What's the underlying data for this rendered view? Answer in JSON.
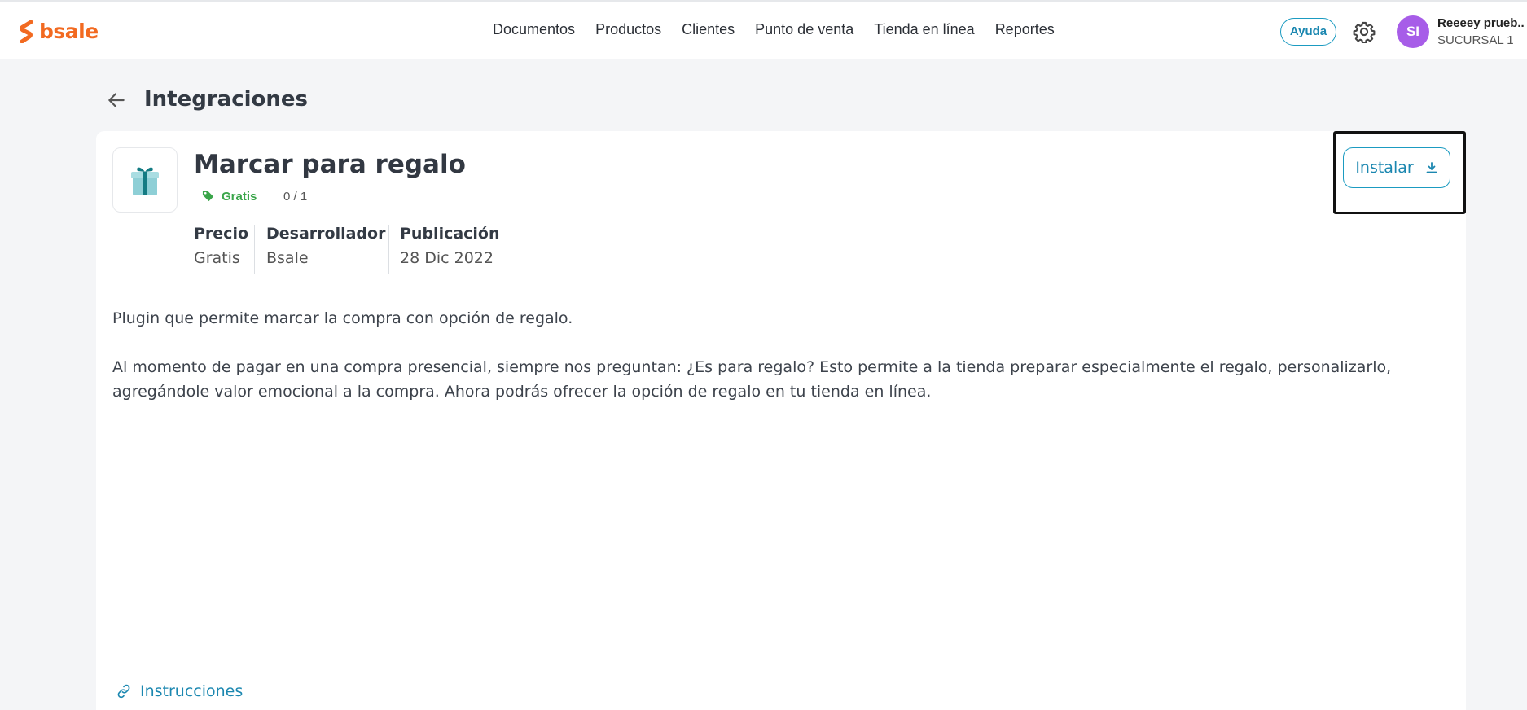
{
  "header": {
    "logo_text": "bsale",
    "nav": [
      "Documentos",
      "Productos",
      "Clientes",
      "Punto de venta",
      "Tienda en línea",
      "Reportes"
    ],
    "help_label": "Ayuda",
    "avatar_initials": "SI",
    "user_name": "Reeeey prueb..",
    "branch": "SUCURSAL 1"
  },
  "page": {
    "title": "Integraciones"
  },
  "app": {
    "name": "Marcar para regalo",
    "tag": "Gratis",
    "installs": "0 / 1",
    "meta": [
      {
        "label": "Precio",
        "value": "Gratis"
      },
      {
        "label": "Desarrollador",
        "value": "Bsale"
      },
      {
        "label": "Publicación",
        "value": "28 Dic 2022"
      }
    ],
    "install_label": "Instalar",
    "description": [
      "Plugin que permite marcar la compra con opción de regalo.",
      "Al momento de pagar en una compra presencial, siempre nos preguntan: ¿Es para regalo? Esto permite a la tienda preparar especialmente el regalo, personalizarlo,",
      "agregándole valor emocional a la compra. Ahora podrás ofrecer la opción de regalo en tu tienda en línea."
    ],
    "instructions_label": "Instrucciones"
  },
  "colors": {
    "brand": "#f26a21",
    "accent": "#1b87b0",
    "free_tag": "#3aa54a",
    "avatar": "#a75de8"
  }
}
